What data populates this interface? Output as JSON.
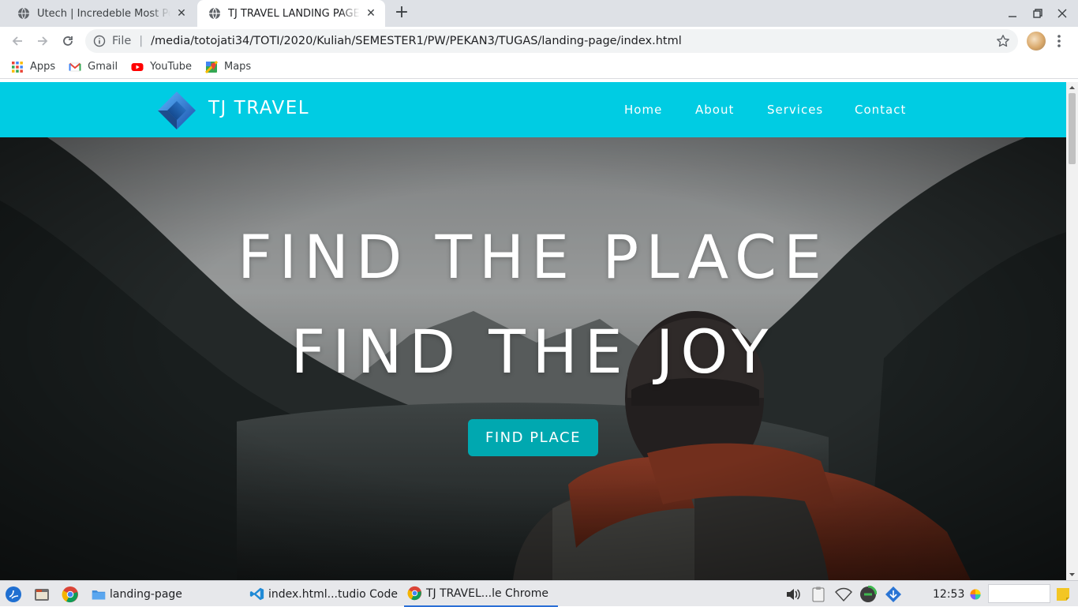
{
  "browser": {
    "tabs": [
      {
        "title": "Utech | Incredeble Most Po",
        "active": false
      },
      {
        "title": "TJ TRAVEL LANDING PAGE",
        "active": true
      }
    ],
    "address": {
      "scheme": "File",
      "url": "/media/totojati34/TOTI/2020/Kuliah/SEMESTER1/PW/PEKAN3/TUGAS/landing-page/index.html"
    },
    "bookmarks": [
      {
        "label": "Apps",
        "icon": "apps-grid-icon"
      },
      {
        "label": "Gmail",
        "icon": "gmail-icon"
      },
      {
        "label": "YouTube",
        "icon": "youtube-icon"
      },
      {
        "label": "Maps",
        "icon": "maps-icon"
      }
    ]
  },
  "site": {
    "brand": "TJ TRAVEL",
    "nav": [
      "Home",
      "About",
      "Services",
      "Contact"
    ],
    "headline_1": "FIND THE PLACE",
    "headline_2": "FIND THE JOY",
    "cta_label": "FIND PLACE",
    "colors": {
      "nav_bg": "#00cce3",
      "cta_bg": "#00a8b0",
      "text": "#ffffff"
    }
  },
  "taskbar": {
    "tasks": [
      {
        "label": "landing-page",
        "icon": "folder-icon"
      },
      {
        "label": "index.html...tudio Code",
        "icon": "vscode-icon"
      },
      {
        "label": "TJ TRAVEL...le Chrome",
        "icon": "chrome-icon",
        "active": true
      }
    ],
    "clock": "12:53"
  }
}
